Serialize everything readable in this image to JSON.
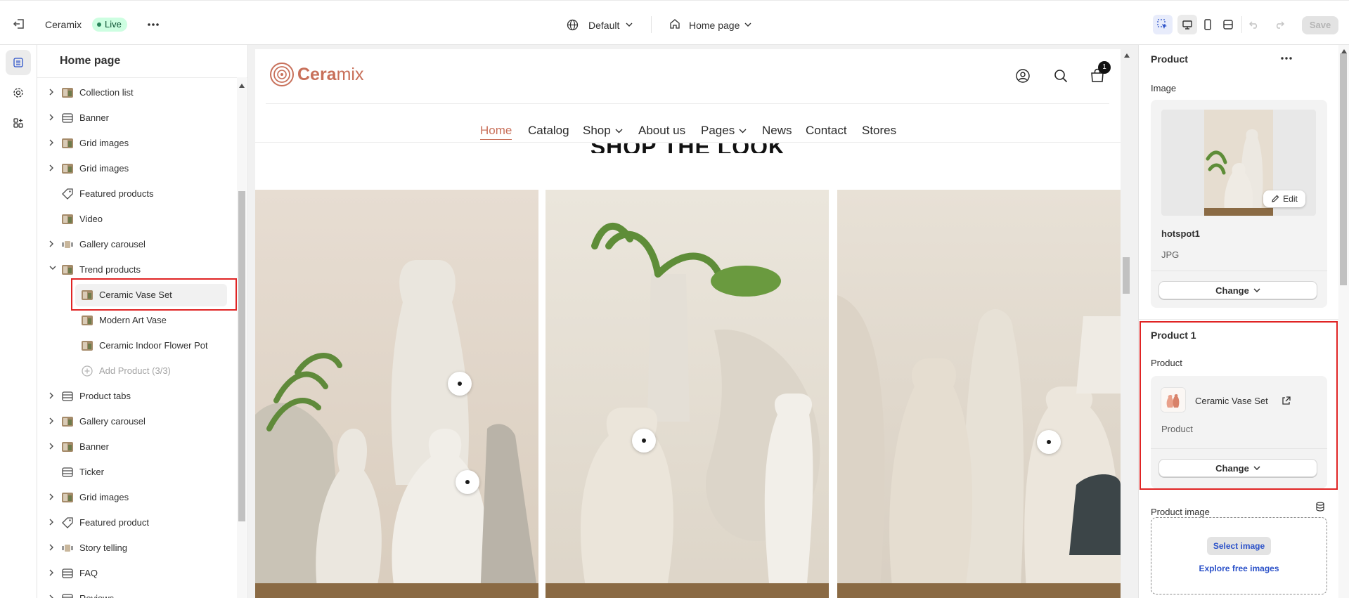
{
  "topbar": {
    "store_name": "Ceramix",
    "status_badge": "Live",
    "theme_selector": "Default",
    "page_selector": "Home page",
    "save_label": "Save"
  },
  "sidebar": {
    "title": "Home page",
    "items": [
      {
        "label": "Collection list"
      },
      {
        "label": "Banner"
      },
      {
        "label": "Grid images"
      },
      {
        "label": "Grid images"
      },
      {
        "label": "Featured products"
      },
      {
        "label": "Video"
      },
      {
        "label": "Gallery carousel"
      },
      {
        "label": "Trend products"
      },
      {
        "label": "Ceramic Vase Set"
      },
      {
        "label": "Modern Art Vase"
      },
      {
        "label": "Ceramic Indoor Flower Pot"
      },
      {
        "label": "Add Product (3/3)"
      },
      {
        "label": "Product tabs"
      },
      {
        "label": "Gallery carousel"
      },
      {
        "label": "Banner"
      },
      {
        "label": "Ticker"
      },
      {
        "label": "Grid images"
      },
      {
        "label": "Featured product"
      },
      {
        "label": "Story telling"
      },
      {
        "label": "FAQ"
      },
      {
        "label": "Reviews"
      }
    ]
  },
  "preview": {
    "logo_text_brand": "Cera",
    "logo_text_rest": "mix",
    "cart_count": "1",
    "nav": [
      "Home",
      "Catalog",
      "Shop",
      "About us",
      "Pages",
      "News",
      "Contact",
      "Stores"
    ],
    "section_heading": "SHOP THE LOOK"
  },
  "panel": {
    "title": "Product",
    "image_label": "Image",
    "edit_label": "Edit",
    "file_name": "hotspot1",
    "file_type": "JPG",
    "change_label": "Change",
    "product1_title": "Product 1",
    "product_label": "Product",
    "product_name": "Ceramic Vase Set",
    "product_sub": "Product",
    "product_image_label": "Product image",
    "select_image_label": "Select image",
    "explore_label": "Explore free images"
  },
  "colors": {
    "accent_red": "#e02424",
    "brand_terracotta": "#c8705a",
    "live_green": "#29845a",
    "link_blue": "#2c52c9"
  }
}
